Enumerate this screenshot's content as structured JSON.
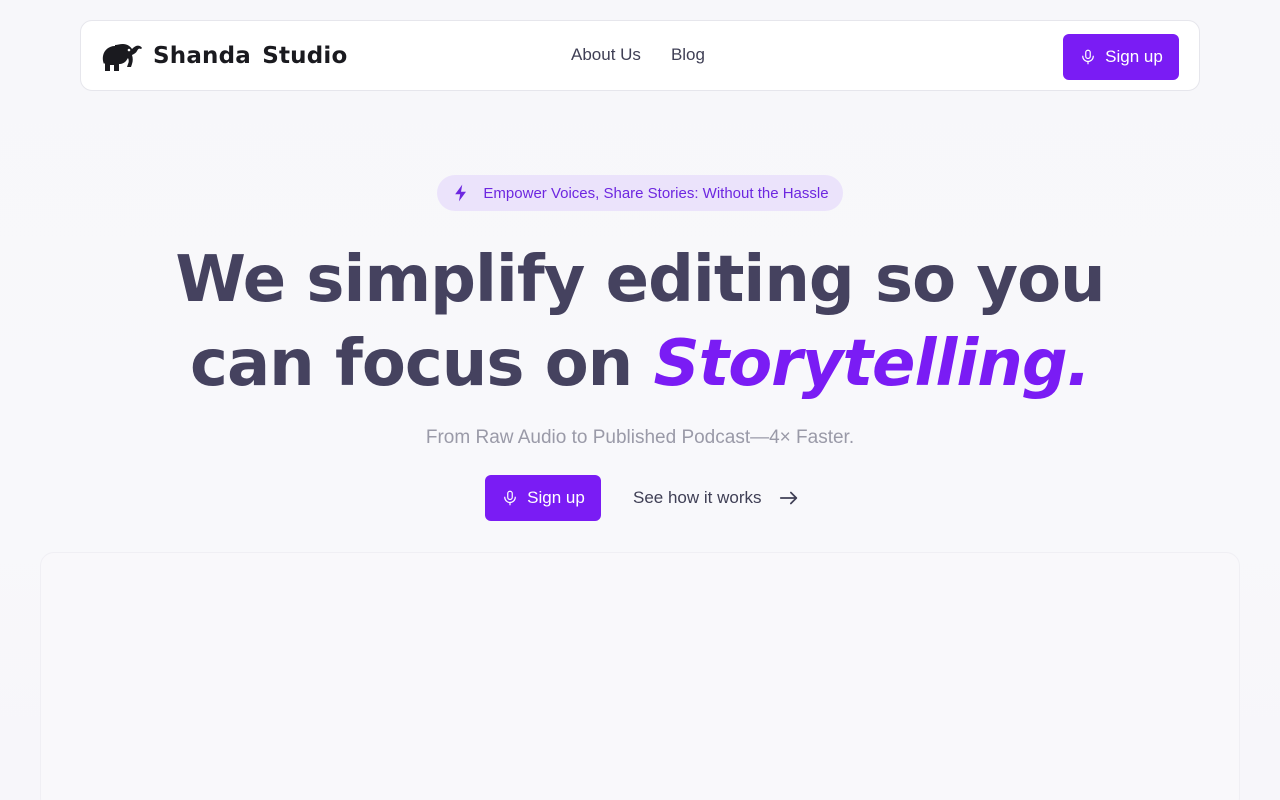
{
  "brand": {
    "name": "Shanda Studio",
    "logo_icon": "elephant-icon"
  },
  "nav": {
    "links": [
      "About Us",
      "Blog"
    ],
    "signup_label": "Sign up",
    "signup_icon": "microphone-icon"
  },
  "hero": {
    "badge": {
      "icon": "lightning-icon",
      "text": "Empower Voices, Share Stories: Without the Hassle"
    },
    "headline_line1": "We simplify editing so you",
    "headline_line2_plain": "can focus on ",
    "headline_line2_accent": "Storytelling.",
    "subheadline": "From Raw Audio to Published Podcast—4× Faster.",
    "signup_label": "Sign up",
    "signup_icon": "microphone-icon",
    "secondary_label": "See how it works",
    "secondary_icon": "arrow-right-icon"
  },
  "colors": {
    "accent": "#7a1cf4",
    "headline": "#45425f",
    "badge_bg": "#ebe3fb",
    "muted_text": "#9a9aa8"
  }
}
